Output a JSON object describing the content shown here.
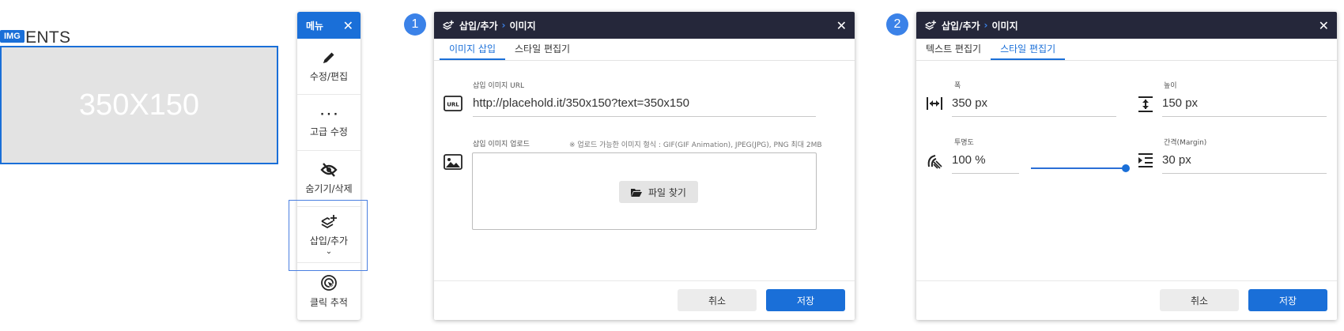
{
  "canvas": {
    "heading": "EMENTS",
    "badge": "IMG",
    "placeholder_text": "350X150"
  },
  "menu": {
    "title": "메뉴",
    "close": "✕",
    "items": [
      {
        "label": "수정/편집",
        "icon": "pencil-icon"
      },
      {
        "label": "고급 수정",
        "icon": "code-braces-icon"
      },
      {
        "label": "숨기기/삭제",
        "icon": "eye-off-icon"
      },
      {
        "label": "삽입/추가",
        "icon": "layers-plus-icon"
      },
      {
        "label": "클릭 추적",
        "icon": "click-target-icon"
      }
    ],
    "chevron": "⌄"
  },
  "steps": [
    "1",
    "2"
  ],
  "dialog1": {
    "title_prefix": "삽입/추가",
    "separator": "›",
    "title": "이미지",
    "close": "✕",
    "tabs": [
      "이미지 삽입",
      "스타일 편집기"
    ],
    "url_label": "삽입 이미지 URL",
    "url_icon_text": "URL",
    "url_value": "http://placehold.it/350x150?text=350x150",
    "upload_label": "삽입 이미지 업로드",
    "upload_hint": "※ 업로드 가능한 이미지 형식 : GIF(GIF Animation), JPEG(JPG), PNG 최대 2MB",
    "find_button": "파일 찾기",
    "cancel": "취소",
    "save": "저장"
  },
  "dialog2": {
    "title_prefix": "삽입/추가",
    "separator": "›",
    "title": "이미지",
    "close": "✕",
    "tabs": [
      "텍스트 편집기",
      "스타일 편집기"
    ],
    "width_label": "폭",
    "width_value": "350 px",
    "height_label": "높이",
    "height_value": "150 px",
    "opacity_label": "투명도",
    "opacity_value": "100 %",
    "opacity_level": 1.0,
    "margin_label": "간격(Margin)",
    "margin_value": "30 px",
    "cancel": "취소",
    "save": "저장"
  },
  "colors": {
    "accent": "#1a6fd8",
    "dialog_header": "#25273a",
    "step_badge": "#3b82e8"
  }
}
